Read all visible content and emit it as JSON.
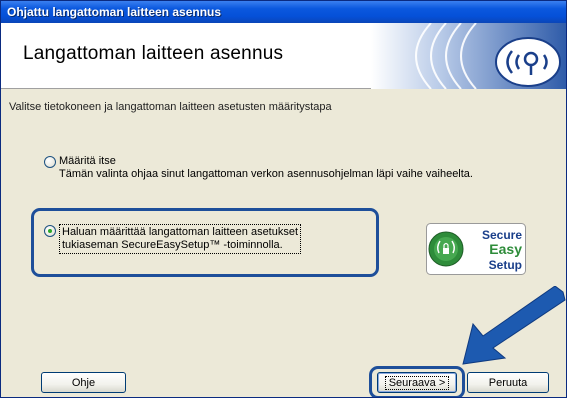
{
  "window": {
    "title": "Ohjattu langattoman laitteen asennus"
  },
  "header": {
    "title": "Langattoman laitteen asennus",
    "graphic_icon": "wireless-signal-icon"
  },
  "instruction": "Valitse tietokoneen ja langattoman laitteen asetusten määritystapa",
  "options": [
    {
      "label": "Määritä itse",
      "description": "Tämän valinta ohjaa sinut langattoman verkon asennusohjelman läpi vaihe vaiheelta.",
      "selected": false
    },
    {
      "line1": "Haluan määrittää langattoman laitteen asetukset",
      "line2": "tukiaseman SecureEasySetup™ -toiminnolla.",
      "selected": true
    }
  ],
  "logo": {
    "line1": "Secure",
    "line2": "Easy",
    "line3": "Setup",
    "icon": "secure-easy-setup-logo"
  },
  "buttons": {
    "help": "Ohje",
    "next": "Seuraava >",
    "cancel": "Peruuta"
  },
  "colors": {
    "titlebar": "#0550d8",
    "highlight_border": "#1e4f9a",
    "arrow": "#1d5ab0",
    "logo_green": "#2e8c3a"
  }
}
